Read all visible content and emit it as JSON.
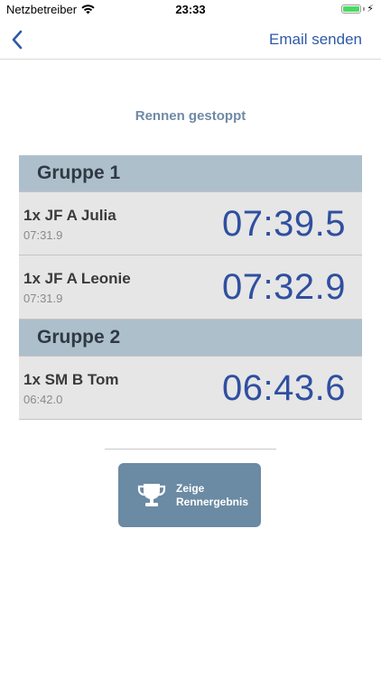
{
  "status_bar": {
    "carrier": "Netzbetreiber",
    "time": "23:33",
    "battery_level": 1.0,
    "battery_color": "#4cd964"
  },
  "nav": {
    "back_icon": "chevron-left-icon",
    "email_label": "Email senden",
    "accent_color": "#2e5aa8"
  },
  "race_status": "Rennen gestoppt",
  "groups": [
    {
      "title": "Gruppe 1",
      "rows": [
        {
          "name": "1x JF A Julia",
          "reference": "07:31.9",
          "time": "07:39.5"
        },
        {
          "name": "1x JF A Leonie",
          "reference": "07:31.9",
          "time": "07:32.9"
        }
      ]
    },
    {
      "title": "Gruppe 2",
      "rows": [
        {
          "name": "1x SM B Tom",
          "reference": "06:42.0",
          "time": "06:43.6"
        }
      ]
    }
  ],
  "result_button": {
    "icon": "trophy-icon",
    "line1": "Zeige",
    "line2": "Rennergebnis",
    "color": "#6b8aa3"
  }
}
